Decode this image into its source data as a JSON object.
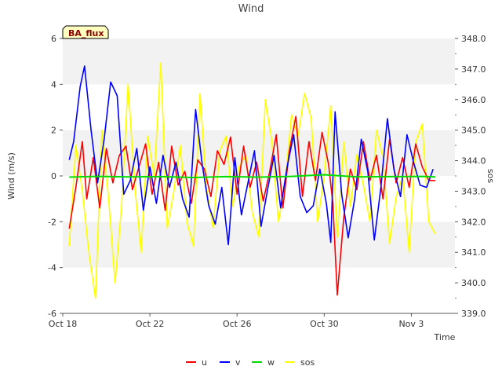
{
  "chart_data": {
    "type": "line",
    "title": "Wind",
    "badge": "BA_flux",
    "xlabel": "Time",
    "ylabel": "Wind (m/s)",
    "y2label": "sos",
    "x_tick_labels": [
      "Oct 18",
      "Oct 22",
      "Oct 26",
      "Oct 30",
      "Nov 3"
    ],
    "x_ticks_day": [
      0,
      4,
      8,
      12,
      16
    ],
    "xlim_day": [
      0,
      18
    ],
    "ylim": [
      -6,
      6
    ],
    "y_ticks": [
      -6,
      -4,
      -2,
      0,
      2,
      4,
      6
    ],
    "y2lim": [
      339.0,
      348.0
    ],
    "y2_ticks": [
      "339.0",
      "340.0",
      "341.0",
      "342.0",
      "343.0",
      "344.0",
      "345.0",
      "346.0",
      "347.0",
      "348.0"
    ],
    "grid_bands": true,
    "legend_position": "bottom",
    "series": [
      {
        "name": "u",
        "color": "#ff0000",
        "axis": "left",
        "x": [
          0.3,
          0.6,
          0.9,
          1.1,
          1.4,
          1.7,
          2.0,
          2.3,
          2.6,
          2.9,
          3.2,
          3.5,
          3.8,
          4.1,
          4.4,
          4.7,
          5.0,
          5.3,
          5.6,
          5.9,
          6.2,
          6.5,
          6.8,
          7.1,
          7.4,
          7.7,
          8.0,
          8.3,
          8.6,
          8.9,
          9.2,
          9.5,
          9.8,
          10.1,
          10.4,
          10.7,
          11.0,
          11.3,
          11.6,
          11.9,
          12.2,
          12.4,
          12.6,
          12.9,
          13.2,
          13.5,
          13.8,
          14.1,
          14.4,
          14.7,
          15.0,
          15.3,
          15.6,
          15.9,
          16.2,
          16.5,
          16.8,
          17.1
        ],
        "y": [
          -2.3,
          -0.5,
          1.5,
          -1.0,
          0.8,
          -1.4,
          1.2,
          -0.3,
          0.9,
          1.3,
          -0.6,
          0.4,
          1.4,
          -0.8,
          0.6,
          -1.5,
          1.3,
          -0.4,
          0.2,
          -1.2,
          0.7,
          0.3,
          -0.9,
          1.1,
          0.5,
          1.7,
          -0.8,
          1.3,
          -0.5,
          0.6,
          -1.1,
          0.2,
          1.8,
          -1.4,
          1.1,
          2.6,
          -0.9,
          1.5,
          -0.2,
          1.9,
          0.5,
          -1.2,
          -5.2,
          -1.8,
          0.3,
          -0.6,
          1.5,
          -0.2,
          0.9,
          -1.0,
          1.6,
          -0.3,
          0.8,
          -0.5,
          1.4,
          0.4,
          -0.2,
          -0.2
        ]
      },
      {
        "name": "v",
        "color": "#0000ff",
        "axis": "left",
        "x": [
          0.3,
          0.5,
          0.8,
          1.0,
          1.3,
          1.6,
          1.9,
          2.2,
          2.5,
          2.8,
          3.1,
          3.4,
          3.7,
          4.0,
          4.3,
          4.6,
          4.9,
          5.2,
          5.5,
          5.8,
          6.1,
          6.4,
          6.7,
          7.0,
          7.3,
          7.6,
          7.9,
          8.2,
          8.5,
          8.8,
          9.1,
          9.4,
          9.7,
          10.0,
          10.3,
          10.6,
          10.9,
          11.2,
          11.5,
          11.8,
          12.1,
          12.3,
          12.5,
          12.8,
          13.1,
          13.4,
          13.7,
          14.0,
          14.3,
          14.6,
          14.9,
          15.2,
          15.5,
          15.8,
          16.1,
          16.4,
          16.7,
          17.0
        ],
        "y": [
          0.7,
          1.5,
          3.9,
          4.8,
          2.0,
          -0.3,
          1.6,
          4.1,
          3.5,
          -0.8,
          -0.2,
          1.2,
          -1.5,
          0.4,
          -1.2,
          0.9,
          -0.5,
          0.6,
          -1.0,
          -1.8,
          2.9,
          0.5,
          -1.3,
          -2.1,
          -0.5,
          -3.0,
          0.8,
          -1.7,
          -0.3,
          1.1,
          -2.2,
          -0.6,
          0.9,
          -1.4,
          0.4,
          1.8,
          -0.9,
          -1.6,
          -1.3,
          0.3,
          -1.2,
          -2.9,
          2.8,
          -0.8,
          -2.7,
          -1.0,
          1.6,
          0.2,
          -2.8,
          -0.5,
          2.5,
          0.3,
          -0.9,
          1.8,
          0.6,
          -0.4,
          -0.5,
          0.3
        ]
      },
      {
        "name": "w",
        "color": "#00dd00",
        "axis": "left",
        "x": [
          0.3,
          1.5,
          3.0,
          4.5,
          6.0,
          7.5,
          9.0,
          10.5,
          12.0,
          13.5,
          15.0,
          16.5,
          17.1
        ],
        "y": [
          -0.05,
          -0.02,
          -0.04,
          -0.03,
          -0.07,
          -0.03,
          -0.05,
          -0.02,
          0.05,
          -0.04,
          -0.03,
          -0.02,
          -0.04
        ]
      },
      {
        "name": "sos",
        "color": "#ffff00",
        "axis": "right",
        "x": [
          0.3,
          0.6,
          0.9,
          1.2,
          1.5,
          1.8,
          2.1,
          2.4,
          2.7,
          3.0,
          3.3,
          3.6,
          3.9,
          4.2,
          4.5,
          4.8,
          5.1,
          5.4,
          5.7,
          6.0,
          6.3,
          6.6,
          6.9,
          7.2,
          7.5,
          7.8,
          8.1,
          8.4,
          8.7,
          9.0,
          9.3,
          9.6,
          9.9,
          10.2,
          10.5,
          10.8,
          11.1,
          11.4,
          11.7,
          12.0,
          12.3,
          12.6,
          12.9,
          13.2,
          13.5,
          13.8,
          14.1,
          14.4,
          14.7,
          15.0,
          15.3,
          15.6,
          15.9,
          16.2,
          16.5,
          16.8,
          17.1
        ],
        "y": [
          341.2,
          344.5,
          343.0,
          341.0,
          339.5,
          345.0,
          342.8,
          340.0,
          342.5,
          346.5,
          343.2,
          341.0,
          344.8,
          343.5,
          347.2,
          341.8,
          343.0,
          344.5,
          342.0,
          341.2,
          346.2,
          343.1,
          341.8,
          344.3,
          344.8,
          342.5,
          343.8,
          344.2,
          342.3,
          341.5,
          346.0,
          344.6,
          342.0,
          343.2,
          345.5,
          344.8,
          346.2,
          345.4,
          342.0,
          343.5,
          345.8,
          341.5,
          344.6,
          342.5,
          344.2,
          343.2,
          342.0,
          345.0,
          344.1,
          341.3,
          342.8,
          343.5,
          341.0,
          344.6,
          345.2,
          342.0,
          341.6
        ]
      }
    ]
  }
}
